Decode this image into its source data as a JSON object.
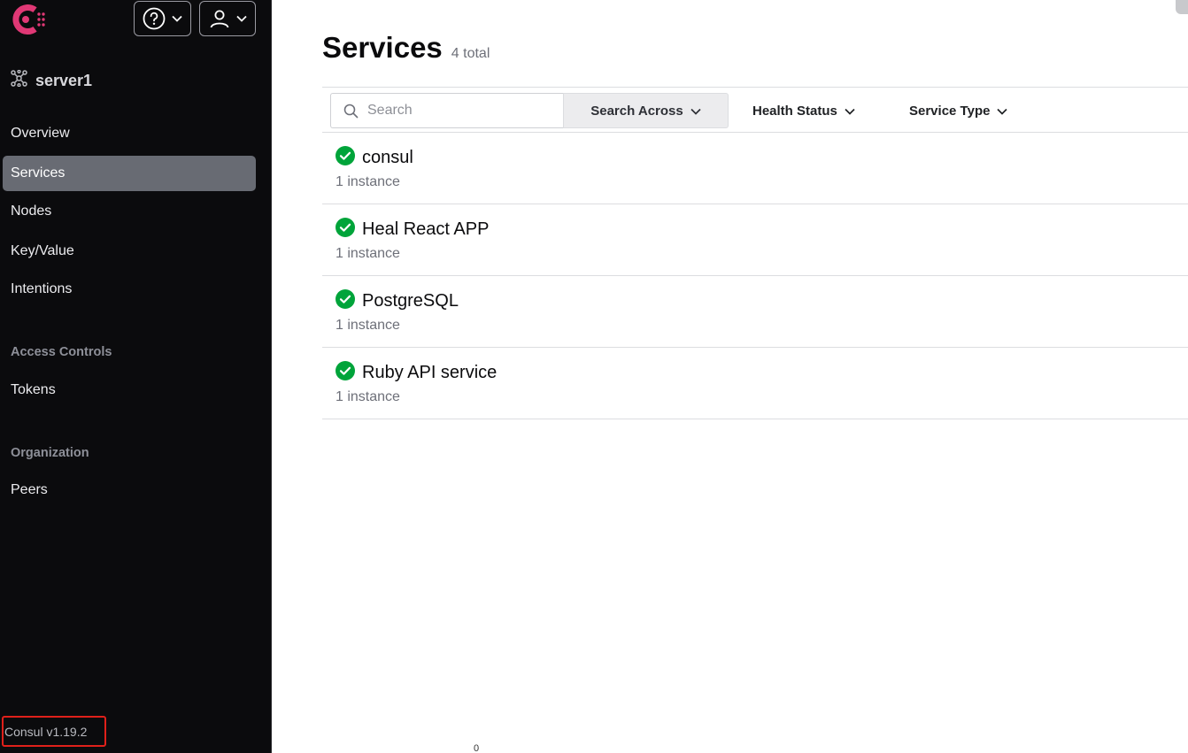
{
  "colors": {
    "sidebar_bg": "#0b0b0d",
    "brand": "#e03875",
    "active_nav": "#686b73",
    "health_passing": "#00a43a",
    "highlight_box": "#e0201a"
  },
  "header": {
    "logo_icon": "consul-logo-icon",
    "help_icon": "question-circle-icon",
    "user_icon": "user-icon"
  },
  "sidebar": {
    "datacenter": "server1",
    "datacenter_icon": "datacenter-icon",
    "nav": [
      {
        "label": "Overview"
      },
      {
        "label": "Services",
        "active": true
      },
      {
        "label": "Nodes"
      },
      {
        "label": "Key/Value"
      },
      {
        "label": "Intentions"
      }
    ],
    "access_controls": {
      "heading": "Access Controls",
      "items": [
        {
          "label": "Tokens"
        }
      ]
    },
    "organization": {
      "heading": "Organization",
      "items": [
        {
          "label": "Peers"
        }
      ]
    },
    "version": "Consul v1.19.2"
  },
  "main": {
    "title": "Services",
    "count": "4 total",
    "search": {
      "placeholder": "Search",
      "value": ""
    },
    "filters": {
      "search_across": "Search Across",
      "health_status": "Health Status",
      "service_type": "Service Type"
    },
    "services": [
      {
        "name": "consul",
        "instances": "1 instance",
        "status": "passing"
      },
      {
        "name": "Heal React APP",
        "instances": "1 instance",
        "status": "passing"
      },
      {
        "name": "PostgreSQL",
        "instances": "1 instance",
        "status": "passing"
      },
      {
        "name": "Ruby API service",
        "instances": "1 instance",
        "status": "passing"
      }
    ]
  },
  "stray_mark": "0"
}
